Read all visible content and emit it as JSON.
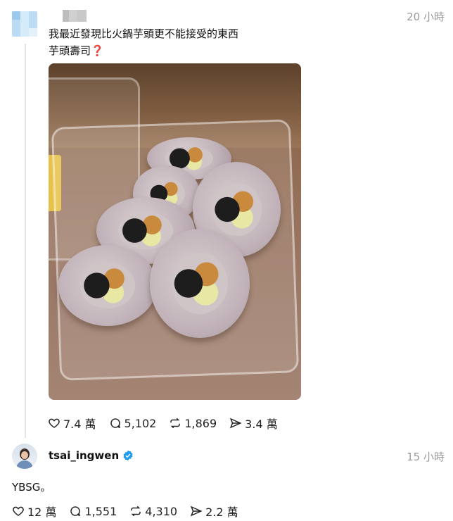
{
  "post": {
    "time": "20 小時",
    "lines": [
      "我最近發現比火鍋芋頭更不能接受的東西",
      "芋頭壽司"
    ],
    "emoji": "❓",
    "stats": {
      "likes": "7.4 萬",
      "comments": "5,102",
      "reposts": "1,869",
      "shares": "3.4 萬"
    }
  },
  "reply": {
    "username": "tsai_ingwen",
    "time": "15 小時",
    "text": "YBSG。",
    "stats": {
      "likes": "12 萬",
      "comments": "1,551",
      "reposts": "4,310",
      "shares": "2.2 萬"
    }
  },
  "colors": {
    "verified": "#1d9bf0",
    "muted": "#9a9a9a",
    "emoji": "#d51e22"
  },
  "icons": [
    "heart-icon",
    "comment-icon",
    "repost-icon",
    "share-icon",
    "verified-badge-icon"
  ]
}
